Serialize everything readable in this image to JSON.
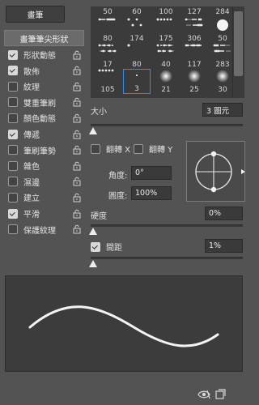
{
  "top_button": {
    "label": "畫筆"
  },
  "tip_shape": {
    "label": "畫筆筆尖形狀"
  },
  "options": [
    {
      "label": "形狀動態",
      "checked": true,
      "locked": true
    },
    {
      "label": "散佈",
      "checked": true,
      "locked": true
    },
    {
      "label": "紋理",
      "checked": false,
      "locked": true
    },
    {
      "label": "雙重筆刷",
      "checked": false,
      "locked": true
    },
    {
      "label": "顏色動態",
      "checked": false,
      "locked": true
    },
    {
      "label": "傳遞",
      "checked": true,
      "locked": true
    },
    {
      "label": "筆刷筆勢",
      "checked": false,
      "locked": true
    },
    {
      "label": "雜色",
      "checked": false,
      "locked": true
    },
    {
      "label": "濕邊",
      "checked": false,
      "locked": true
    },
    {
      "label": "建立",
      "checked": false,
      "locked": true
    },
    {
      "label": "平滑",
      "checked": true,
      "locked": true
    },
    {
      "label": "保護紋理",
      "checked": false,
      "locked": true
    }
  ],
  "brushes": [
    {
      "num": "50"
    },
    {
      "num": "60"
    },
    {
      "num": "100"
    },
    {
      "num": "127"
    },
    {
      "num": "284"
    },
    {
      "num": "80"
    },
    {
      "num": "174"
    },
    {
      "num": "175"
    },
    {
      "num": "306"
    },
    {
      "num": "50"
    },
    {
      "num": "17"
    },
    {
      "num": "80"
    },
    {
      "num": "40"
    },
    {
      "num": "117"
    },
    {
      "num": "283"
    },
    {
      "num": "105"
    },
    {
      "num": "3"
    },
    {
      "num": "21"
    },
    {
      "num": "25"
    },
    {
      "num": "30"
    }
  ],
  "selected_brush": 16,
  "size": {
    "label": "大小",
    "value": "3 圖元",
    "slider": 0.0
  },
  "flip_x": {
    "label": "翻轉 X",
    "checked": false
  },
  "flip_y": {
    "label": "翻轉 Y",
    "checked": false
  },
  "angle": {
    "label": "角度:",
    "value": "0°"
  },
  "roundness": {
    "label": "圓度:",
    "value": "100%"
  },
  "hardness": {
    "label": "硬度",
    "value": "0%",
    "slider": 0.0
  },
  "spacing": {
    "label": "間距",
    "value": "1%",
    "checked": true,
    "slider": 0.01
  },
  "colors": {
    "panel": "#535353",
    "field": "#3a3a3a",
    "accent": "#2e8ff0"
  }
}
